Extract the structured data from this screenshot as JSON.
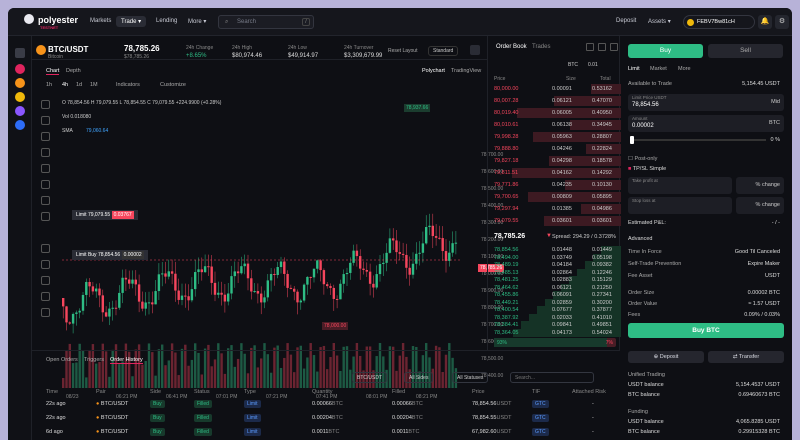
{
  "nav": {
    "brand": "polyester",
    "brand_sub": "TESTNET",
    "markets": "Markets",
    "trade": "Trade",
    "lending": "Lending",
    "more": "More",
    "search_placeholder": "Search",
    "search_key": "/",
    "deposit": "Deposit",
    "assets": "Assets",
    "account": "FEBV7Bw81cH"
  },
  "ticker": {
    "pair": "BTC/USDT",
    "name": "Bitcoin",
    "price": "78,785.26",
    "price_sub": "$78,785.26",
    "stats": [
      {
        "label": "24h Change",
        "value": "+8.65%"
      },
      {
        "label": "24h High",
        "value": "$80,974.46"
      },
      {
        "label": "24h Low",
        "value": "$49,914.97"
      },
      {
        "label": "24h Turnover",
        "value": "$3,309,679.99"
      }
    ],
    "reset_layout": "Reset Layout",
    "layout_select": "Standard"
  },
  "chart": {
    "tabs": [
      "Chart",
      "Depth"
    ],
    "views": [
      "Polychart",
      "TradingView"
    ],
    "intervals": [
      "1h",
      "4h",
      "1d",
      "1M"
    ],
    "indicators": "Indicators",
    "customize": "Customize",
    "ohlc": "O 78,854.56  H 79,079.55  L 78,854.55  C 79,079.55  +224.9900 (+0.28%)",
    "vol": "Vol 0.018080",
    "sma": "SMA",
    "sma_val": "79,060.64",
    "limit_label": "Limit 79,079.55",
    "limit_qty": "0.03767",
    "limit_buy_label": "Limit Buy 78,854.56",
    "limit_buy_qty": "0.00002",
    "y_ticks": [
      "78,700.00",
      "78,600.00",
      "78,500.00",
      "78,400.00",
      "78,300.00",
      "78,200.00",
      "78,100.00",
      "78,000.00",
      "78,900.00",
      "78,800.00",
      "78,700.00",
      "78,600.00",
      "78,500.00",
      "78,400.00"
    ],
    "x_ticks": [
      "08/23",
      "06:21 PM",
      "06:41 PM",
      "07:01 PM",
      "07:21 PM",
      "07:41 PM",
      "08:01 PM",
      "08:21 PM"
    ],
    "top_tag": "78,937.66",
    "price_tag": "78,785.26",
    "bottom_tag": "78,000.00"
  },
  "orderbook": {
    "tabs": [
      "Order Book",
      "Trades"
    ],
    "symbol": "BTC",
    "step": "0.01",
    "cols": [
      "Price",
      "Size",
      "Total"
    ],
    "asks": [
      [
        "80,000.00",
        "0.00091",
        "0.53162"
      ],
      [
        "80,007.28",
        "0.06121",
        "0.47070"
      ],
      [
        "80,019.40",
        "0.06005",
        "0.40950"
      ],
      [
        "80,010.61",
        "0.06138",
        "0.34945"
      ],
      [
        "79,998.28",
        "0.05963",
        "0.28807"
      ],
      [
        "79,888.80",
        "0.04246",
        "0.22824"
      ],
      [
        "79,827.18",
        "0.04298",
        "0.18578"
      ],
      [
        "79,811.51",
        "0.04162",
        "0.14292"
      ],
      [
        "79,771.86",
        "0.04235",
        "0.10130"
      ],
      [
        "79,700.65",
        "0.00809",
        "0.05895"
      ],
      [
        "79,297.94",
        "0.01385",
        "0.04986"
      ],
      [
        "79,079.55",
        "0.03601",
        "0.03601"
      ]
    ],
    "spread_price": "78,785.26",
    "spread": "Spread: 294.29 / 0.3728%",
    "bids": [
      [
        "78,854.56",
        "0.01448",
        "0.01449"
      ],
      [
        "78,494.00",
        "0.03749",
        "0.05198"
      ],
      [
        "78,489.19",
        "0.04184",
        "0.09382"
      ],
      [
        "78,485.13",
        "0.02864",
        "0.12246"
      ],
      [
        "78,481.25",
        "0.02883",
        "0.15129"
      ],
      [
        "78,464.62",
        "0.06121",
        "0.21250"
      ],
      [
        "78,455.86",
        "0.06091",
        "0.27341"
      ],
      [
        "78,449.21",
        "0.02859",
        "0.30200"
      ],
      [
        "78,400.54",
        "0.07677",
        "0.37877"
      ],
      [
        "78,387.92",
        "0.02033",
        "0.41010"
      ],
      [
        "78,384.41",
        "0.09841",
        "0.49851"
      ],
      [
        "78,364.05",
        "0.04173",
        "0.54024"
      ]
    ],
    "buy_pct": "93%",
    "sell_pct": "7%"
  },
  "trade": {
    "buy": "Buy",
    "sell": "Sell",
    "types": [
      "Limit",
      "Market",
      "More"
    ],
    "available_label": "Available to Trade",
    "available": "5,154.45 USDT",
    "limit_label": "Limit Price USDT",
    "limit_val": "78,854.56",
    "mid": "Mid",
    "amount_label": "Amount",
    "amount_val": "0.00002",
    "amount_unit": "BTC",
    "pct": "0 %",
    "post_only": "Post-only",
    "tpsl": "TP/SL",
    "tpsl_mode": "Simple",
    "tp_label": "Take profit at",
    "sl_label": "Stop loss at",
    "change": "% change",
    "est_pnl": "Estimated P&L:",
    "est_pnl_val": "- / -",
    "advanced": "Advanced",
    "adv": [
      [
        "Time In Force",
        "Good Til Canceled"
      ],
      [
        "Self-Trade Prevention",
        "Expire Maker"
      ],
      [
        "Fee Asset",
        "USDT"
      ]
    ],
    "summary": [
      [
        "Order Size",
        "0.00002 BTC"
      ],
      [
        "Order Value",
        "≈ 1.57 USDT"
      ],
      [
        "Fees",
        "0.09% / 0.03%"
      ]
    ],
    "submit": "Buy BTC",
    "deposit": "Deposit",
    "transfer": "Transfer",
    "unified_title": "Unified Trading",
    "unified": [
      [
        "USDT balance",
        "5,154.4537 USDT"
      ],
      [
        "BTC balance",
        "0.69460673 BTC"
      ]
    ],
    "funding_title": "Funding",
    "funding": [
      [
        "USDT balance",
        "4,065.8285 USDT"
      ],
      [
        "BTC balance",
        "0.29915328 BTC"
      ]
    ]
  },
  "orders": {
    "tabs": [
      "Open Orders",
      "Triggers",
      "Order History"
    ],
    "filters": [
      "BTC/USDT",
      "All Sides",
      "All Statuses"
    ],
    "search_placeholder": "Search...",
    "cols": [
      "Time",
      "Pair",
      "Side",
      "Status",
      "Type",
      "Quantity",
      "Filled",
      "Price",
      "TIF",
      "Attached Risk"
    ],
    "rows": [
      [
        "22s ago",
        "BTC/USDT",
        "Buy",
        "Filled",
        "Limit",
        "0.00066",
        "0.00066",
        "78,854.56",
        "GTC",
        "-"
      ],
      [
        "22s ago",
        "BTC/USDT",
        "Buy",
        "Filled",
        "Limit",
        "0.00204",
        "0.00204",
        "78,854.55",
        "GTC",
        "-"
      ],
      [
        "6d ago",
        "BTC/USDT",
        "Buy",
        "Filled",
        "Limit",
        "0.0011",
        "0.0011",
        "67,982.60",
        "GTC",
        "-"
      ]
    ],
    "qty_unit": "BTC",
    "price_unit": "USDT"
  },
  "colors": {
    "green": "#2ebd85",
    "red": "#f6465d",
    "accent": "#e0245e"
  }
}
